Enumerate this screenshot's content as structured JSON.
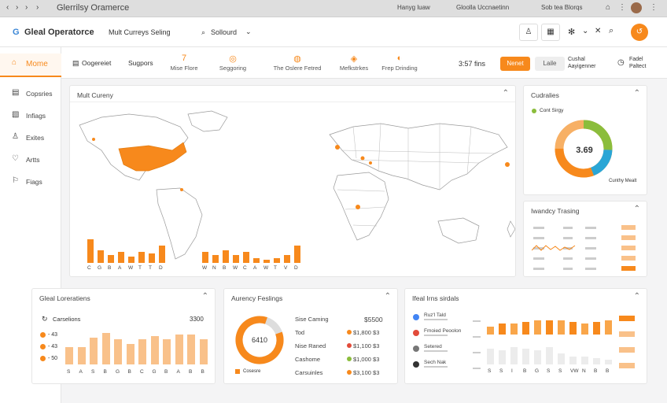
{
  "browser": {
    "title": "Glerrilsy Oramerce",
    "tab1": "Hanyg luaw",
    "tab2": "Gloolla Uccnaetinn",
    "tab3": "Sob tea Blorqs"
  },
  "app": {
    "logo": "Gleal Operatorce",
    "menu1": "Mult Curreys Seling",
    "search_label": "Sollourd"
  },
  "sidebar": {
    "items": [
      {
        "label": "Mome",
        "icon": "home-icon"
      },
      {
        "label": "Copsries"
      },
      {
        "label": "Infiags"
      },
      {
        "label": "Exites"
      },
      {
        "label": "Artts"
      },
      {
        "label": "Fiags"
      }
    ]
  },
  "toolbar": {
    "overview": "Oogereiet",
    "support": "Sugpors",
    "t1": "Mise Flore",
    "t2": "Seggoring",
    "t3": "The Oslere Fetred",
    "t4": "Mefkstrkes",
    "t5": "Frep Drinding",
    "rate": "3:57 fins",
    "btn1": "Nenet",
    "btn2": "Laile",
    "c1": "Cushal Aayigenner",
    "c2": "Fadel Paltect"
  },
  "map_card": {
    "title": "Mult Cureny",
    "bar_labels_left": [
      "C",
      "G",
      "B",
      "A",
      "W",
      "T",
      "T",
      "D"
    ],
    "bar_labels_right": [
      "W",
      "N",
      "B",
      "W",
      "C",
      "A",
      "W",
      "T",
      "V",
      "D"
    ]
  },
  "currencies_card": {
    "title": "Cudralies",
    "legend": "Cont Sirgy",
    "center": "3.69",
    "legend2": "Cunthy Mealt"
  },
  "trading_card": {
    "title": "Iwandcy Trasing"
  },
  "global_card": {
    "title": "Gleal Loreratiens",
    "sub": "Carselions",
    "value": "3300",
    "rows": [
      "- 43",
      "- 43",
      "- 50"
    ],
    "xlabels": [
      "S",
      "A",
      "S",
      "B",
      "G",
      "B",
      "C",
      "G",
      "B",
      "A",
      "B",
      "B"
    ]
  },
  "currency_card": {
    "title": "Aurency Feslings",
    "center": "6410",
    "rows": [
      {
        "label": "Sise Caming",
        "value": "$5500"
      },
      {
        "label": "Tod",
        "value": "$1,800 $3"
      },
      {
        "label": "Nise Raned",
        "value": "$1,100 $3"
      },
      {
        "label": "Cashome",
        "value": "$1,000 $3"
      },
      {
        "label": "Carsuinles",
        "value": "$3,100 $3"
      }
    ],
    "legend": "Cosesre"
  },
  "trans_card": {
    "title": "Ifeal Irns sirdals",
    "rows": [
      {
        "name": "Ruz'l Tald"
      },
      {
        "name": "Fmoied Peoolon"
      },
      {
        "name": "Setered"
      },
      {
        "name": "Sech Nak"
      }
    ],
    "xlabels": [
      "S",
      "S",
      "I",
      "B",
      "G",
      "S",
      "S",
      "VW",
      "N",
      "B",
      "B"
    ]
  },
  "colors": {
    "accent": "#f7891c",
    "light": "#f9c18a",
    "green": "#8bbd3c",
    "blue": "#2aa6d6"
  }
}
